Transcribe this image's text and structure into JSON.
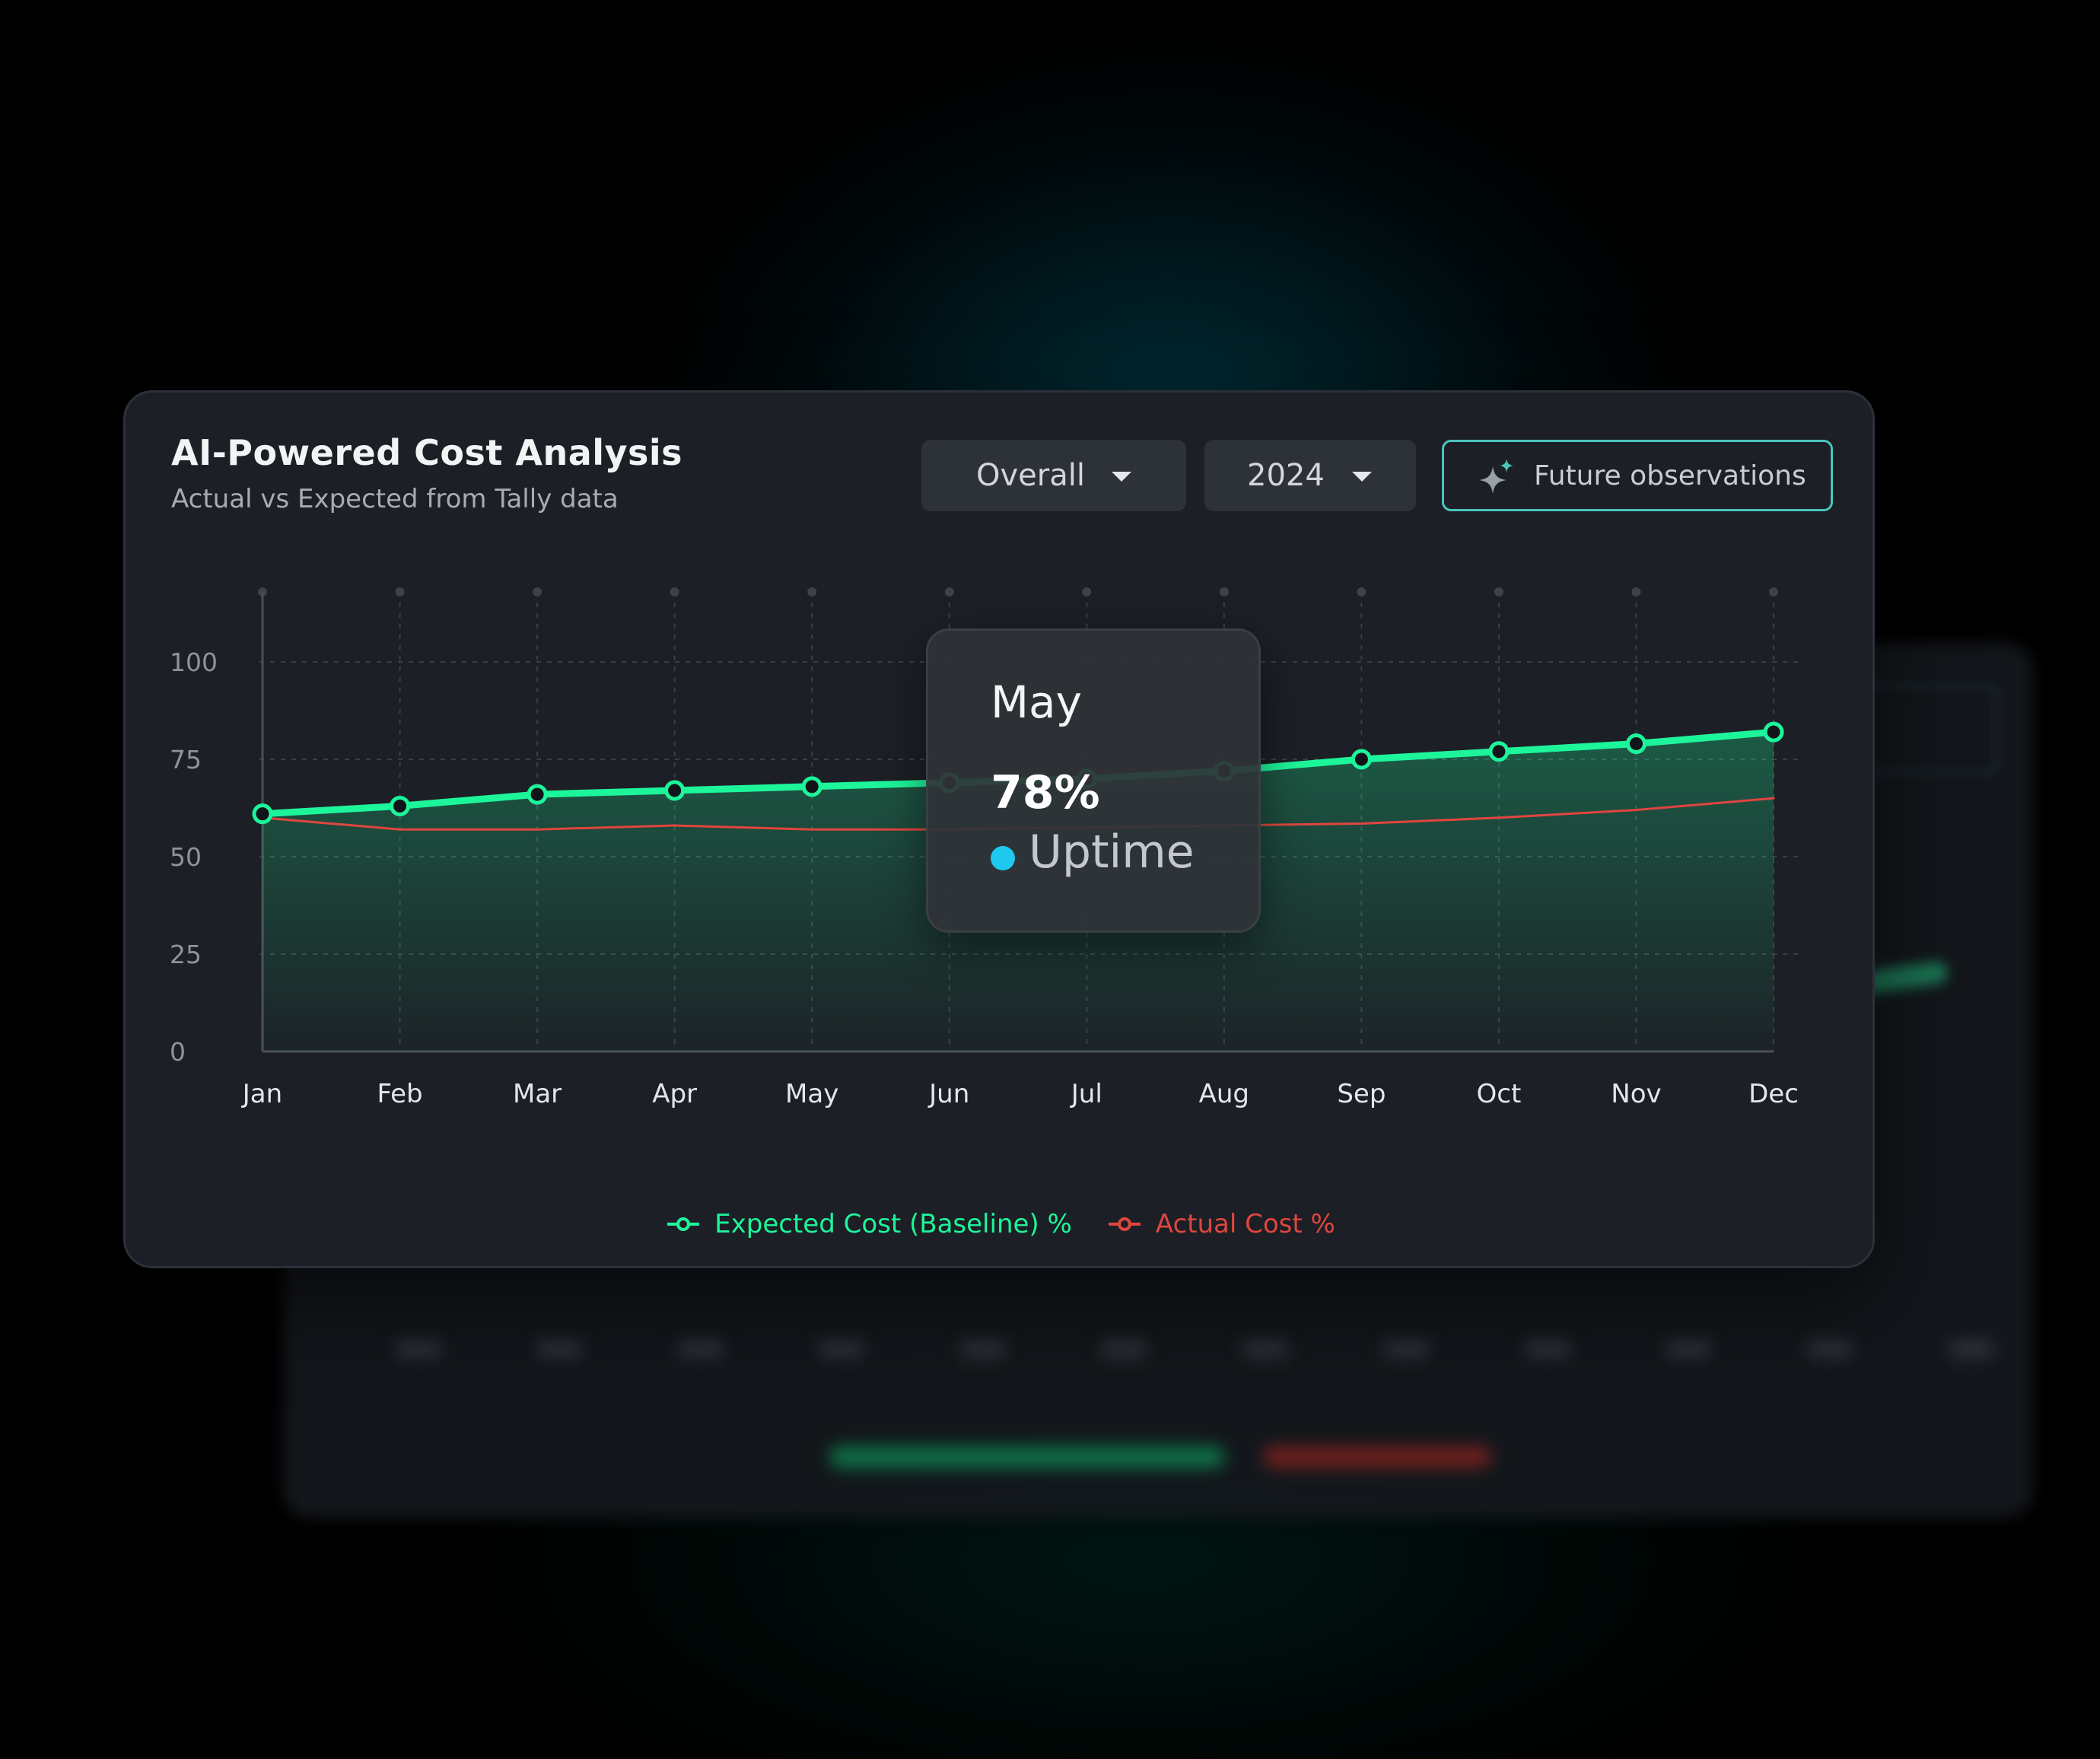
{
  "header": {
    "title": "AI-Powered Cost Analysis",
    "subtitle": "Actual vs Expected from Tally data"
  },
  "filters": {
    "scope": "Overall",
    "year": "2024"
  },
  "actions": {
    "future_label": "Future observations",
    "future_icon": "sparkle-icon"
  },
  "tooltip": {
    "month": "May",
    "value": "78%",
    "label": "Uptime",
    "dot_color": "#1ec8ef"
  },
  "colors": {
    "expected": "#1df59a",
    "actual": "#e0453f",
    "accent_border": "#49c5bb"
  },
  "chart_data": {
    "type": "line",
    "title": "AI-Powered Cost Analysis",
    "subtitle": "Actual vs Expected from Tally data",
    "categories": [
      "Jan",
      "Feb",
      "Mar",
      "Apr",
      "May",
      "Jun",
      "Jul",
      "Aug",
      "Sep",
      "Oct",
      "Nov",
      "Dec"
    ],
    "yticks": [
      0,
      25,
      50,
      75,
      100
    ],
    "ylim": [
      0,
      100
    ],
    "grid": true,
    "legend_position": "bottom-center",
    "series": [
      {
        "name": "Expected Cost (Baseline) %",
        "color": "#1df59a",
        "values": [
          61,
          63,
          66,
          67,
          68,
          69,
          70,
          72,
          75,
          77,
          79,
          82
        ],
        "area": true,
        "markers": true
      },
      {
        "name": "Actual Cost %",
        "color": "#e0453f",
        "values": [
          60,
          57,
          57,
          58,
          57,
          57,
          57.5,
          58,
          58.5,
          60,
          62,
          65
        ],
        "area": false,
        "markers": false
      }
    ]
  }
}
